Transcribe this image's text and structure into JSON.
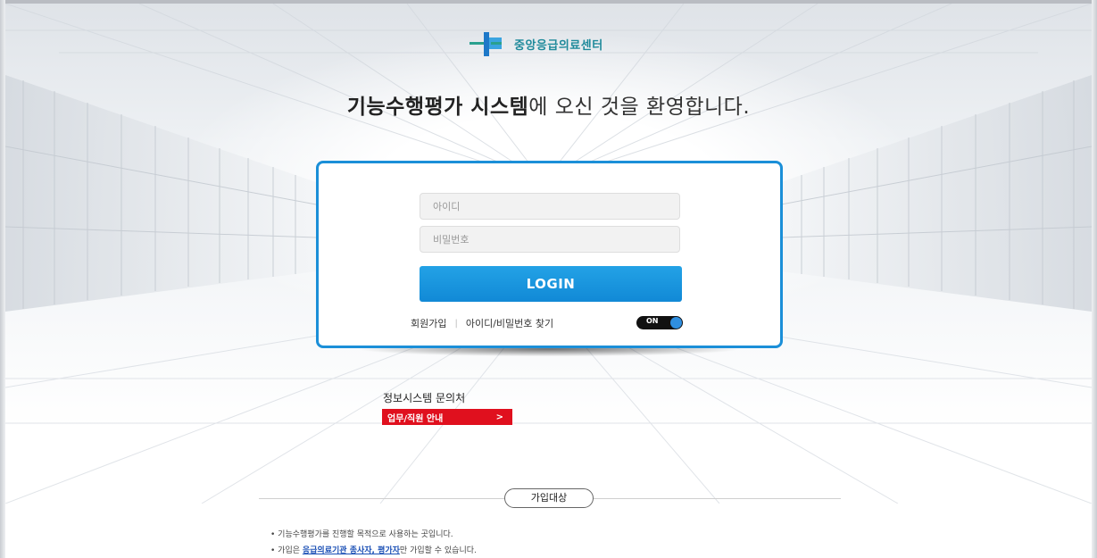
{
  "brand": {
    "name": "중앙응급의료센터",
    "color": "#1f8a9b"
  },
  "welcome": {
    "bold": "기능수행평가 시스템",
    "rest": "에 오신 것을 환영합니다."
  },
  "login": {
    "id_placeholder": "아이디",
    "pw_placeholder": "비밀번호",
    "button_label": "LOGIN",
    "signup_label": "회원가입",
    "separator": "|",
    "find_label": "아이디/비밀번호 찾기",
    "toggle_label": "ON",
    "accent_color": "#1b8fd8"
  },
  "inquiry": {
    "title": "정보시스템 문의처",
    "button_label": "업무/직원 안내",
    "button_arrow": ">"
  },
  "target": {
    "label": "가입대상",
    "note1": "• 기능수행평가를 진행할 목적으로 사용하는 곳입니다.",
    "note2_prefix": "• 가입은 ",
    "note2_highlight": "응급의료기관 종사자, 평가자",
    "note2_suffix": "만 가입할 수 있습니다."
  }
}
